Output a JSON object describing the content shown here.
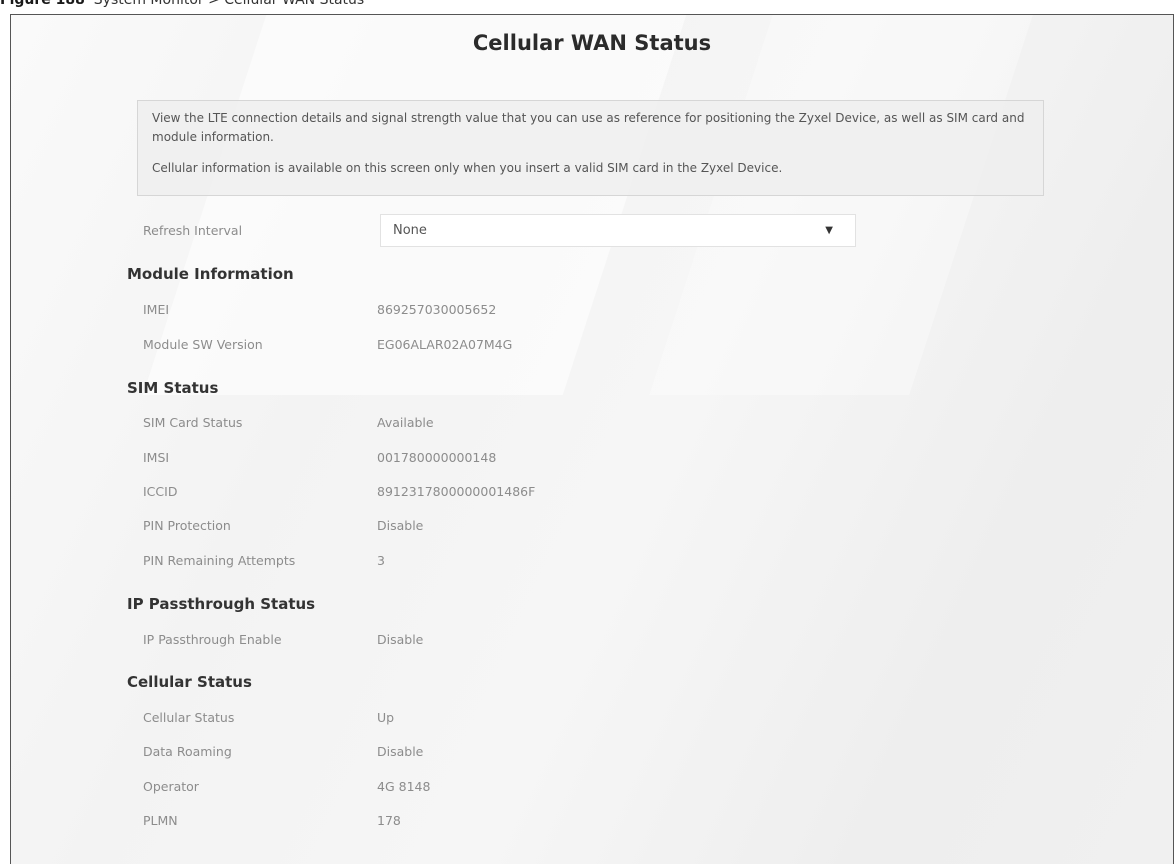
{
  "caption": {
    "figure": "Figure 188",
    "text": "System Monitor > Cellular WAN Status"
  },
  "page": {
    "title": "Cellular WAN Status"
  },
  "description": {
    "line1": "View the LTE connection details and signal strength value that you can use as reference for positioning the Zyxel Device, as well as SIM card and module information.",
    "line2": "Cellular information is available on this screen only when you insert a valid SIM card in the Zyxel Device."
  },
  "refresh": {
    "label": "Refresh Interval",
    "value": "None",
    "icon": "chevron-down-icon"
  },
  "module": {
    "heading": "Module Information",
    "imei_label": "IMEI",
    "imei": "869257030005652",
    "sw_label": "Module SW Version",
    "sw": "EG06ALAR02A07M4G"
  },
  "sim": {
    "heading": "SIM Status",
    "card_status_label": "SIM Card Status",
    "card_status": "Available",
    "imsi_label": "IMSI",
    "imsi": "001780000000148",
    "iccid_label": "ICCID",
    "iccid": "8912317800000001486F",
    "pin_protection_label": "PIN Protection",
    "pin_protection": "Disable",
    "pin_attempts_label": "PIN Remaining Attempts",
    "pin_attempts": "3"
  },
  "passthrough": {
    "heading": "IP Passthrough Status",
    "enable_label": "IP Passthrough Enable",
    "enable": "Disable"
  },
  "cellular": {
    "heading": "Cellular Status",
    "status_label": "Cellular Status",
    "status": "Up",
    "roaming_label": "Data Roaming",
    "roaming": "Disable",
    "operator_label": "Operator",
    "operator": "4G 8148",
    "plmn_label": "PLMN",
    "plmn": "178"
  }
}
